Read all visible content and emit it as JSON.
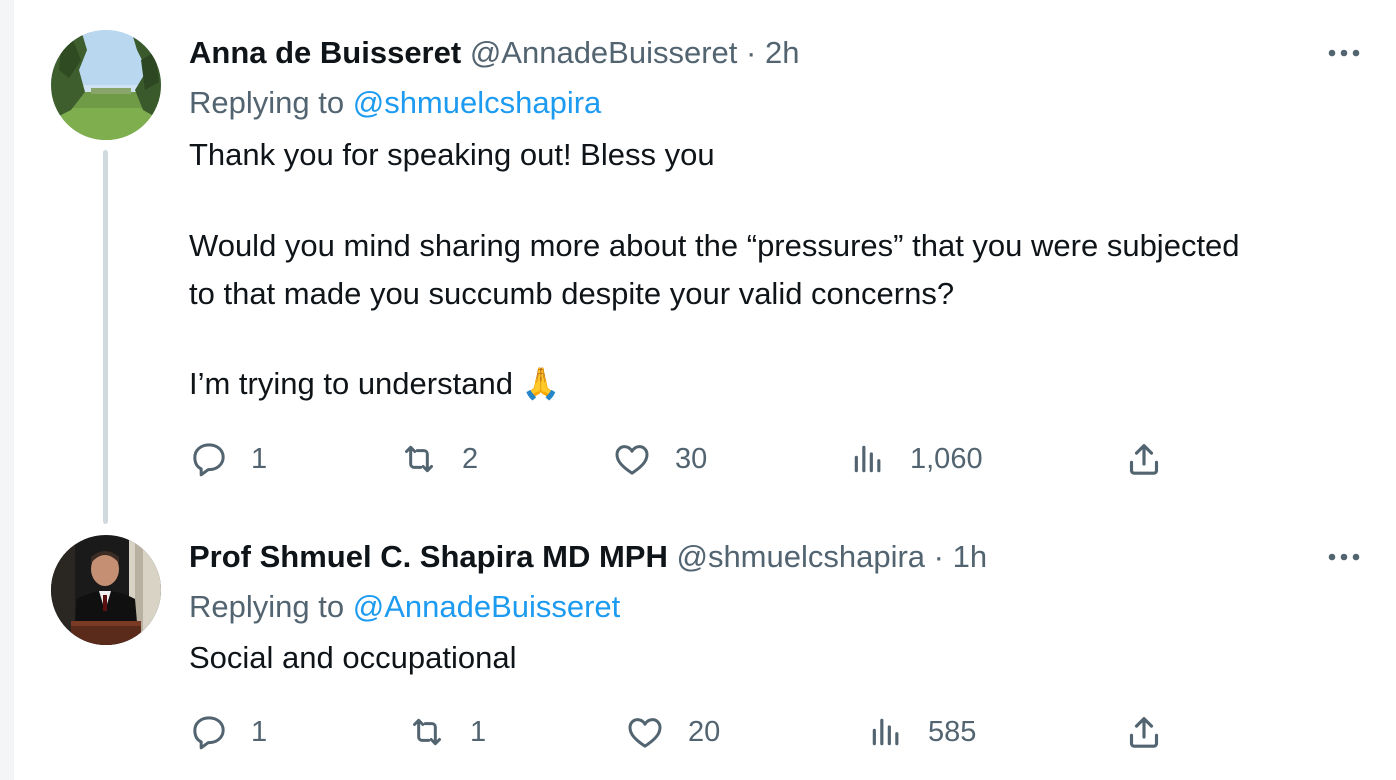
{
  "tweets": [
    {
      "display_name": "Anna de Buisseret",
      "handle": "@AnnadeBuisseret",
      "separator": "·",
      "time": "2h",
      "replying_prefix": "Replying to",
      "replying_to": "@shmuelcshapira",
      "body_lines": [
        "Thank you for speaking out! Bless you",
        "Would you mind sharing more about the “pressures” that you were subjected",
        "to that made you succumb despite your valid concerns?",
        "I’m trying to understand 🙏"
      ],
      "replies": "1",
      "retweets": "2",
      "likes": "30",
      "views": "1,060"
    },
    {
      "display_name": "Prof Shmuel C. Shapira MD MPH",
      "handle": "@shmuelcshapira",
      "separator": "·",
      "time": "1h",
      "replying_prefix": "Replying to",
      "replying_to": "@AnnadeBuisseret",
      "body_lines": [
        "Social and occupational"
      ],
      "replies": "1",
      "retweets": "1",
      "likes": "20",
      "views": "585"
    }
  ],
  "icons": {
    "reply": "reply-icon",
    "retweet": "retweet-icon",
    "like": "heart-icon",
    "views": "views-icon",
    "share": "share-icon",
    "more": "more-icon"
  },
  "colors": {
    "text": "#0f1419",
    "secondary": "#536471",
    "link": "#1d9bf0",
    "thread_line": "#cfd9de"
  }
}
